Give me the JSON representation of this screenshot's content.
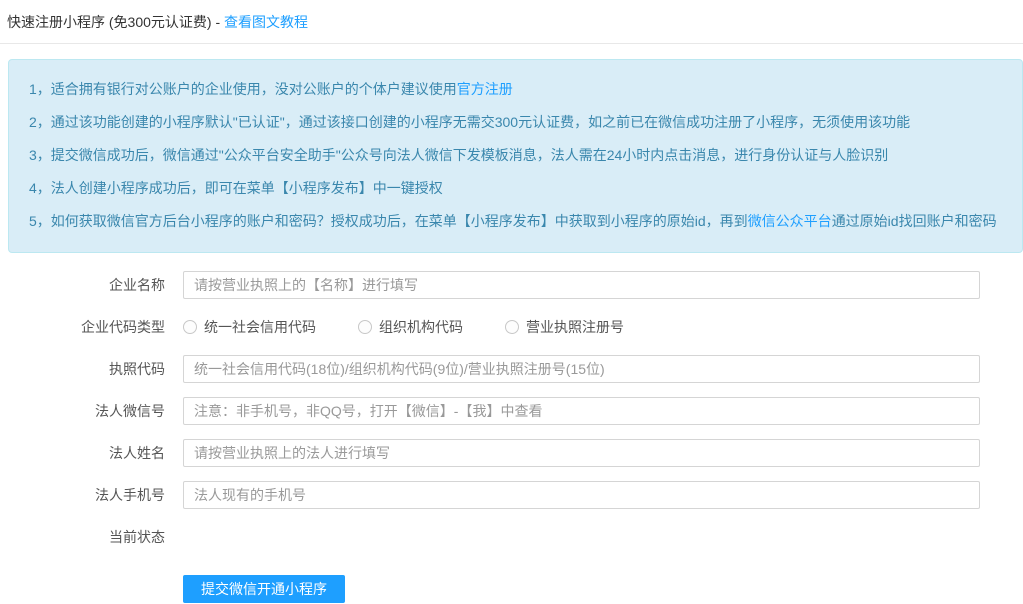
{
  "header": {
    "title": "快速注册小程序 (免300元认证费) - ",
    "tutorial_link": "查看图文教程"
  },
  "notice": {
    "lines": [
      {
        "prefix": "1，适合拥有银行对公账户的企业使用，没对公账户的个体户建议使用",
        "link": "官方注册",
        "suffix": ""
      },
      {
        "text": "2，通过该功能创建的小程序默认\"已认证\"，通过该接口创建的小程序无需交300元认证费，如之前已在微信成功注册了小程序，无须使用该功能"
      },
      {
        "text": "3，提交微信成功后，微信通过\"公众平台安全助手\"公众号向法人微信下发模板消息，法人需在24小时内点击消息，进行身份认证与人脸识别"
      },
      {
        "text": "4，法人创建小程序成功后，即可在菜单【小程序发布】中一键授权"
      },
      {
        "prefix": "5，如何获取微信官方后台小程序的账户和密码？授权成功后，在菜单【小程序发布】中获取到小程序的原始id，再到",
        "link": "微信公众平台",
        "suffix": "通过原始id找回账户和密码"
      }
    ]
  },
  "form": {
    "company_name": {
      "label": "企业名称",
      "value": "",
      "placeholder": "请按营业执照上的【名称】进行填写"
    },
    "code_type": {
      "label": "企业代码类型",
      "options": [
        "统一社会信用代码",
        "组织机构代码",
        "营业执照注册号"
      ],
      "selected": ""
    },
    "license_code": {
      "label": "执照代码",
      "value": "",
      "placeholder": "统一社会信用代码(18位)/组织机构代码(9位)/营业执照注册号(15位)"
    },
    "legal_wechat": {
      "label": "法人微信号",
      "value": "",
      "placeholder": "注意：非手机号，非QQ号，打开【微信】-【我】中查看"
    },
    "legal_name": {
      "label": "法人姓名",
      "value": "",
      "placeholder": "请按营业执照上的法人进行填写"
    },
    "legal_phone": {
      "label": "法人手机号",
      "value": "",
      "placeholder": "法人现有的手机号"
    },
    "current_status": {
      "label": "当前状态",
      "value": ""
    },
    "submit_label": "提交微信开通小程序"
  },
  "colors": {
    "link_blue": "#1e9fff",
    "notice_bg": "#d9edf7",
    "notice_border": "#bce8f1",
    "notice_text": "#3a87ad",
    "button_bg": "#1e9fff"
  }
}
